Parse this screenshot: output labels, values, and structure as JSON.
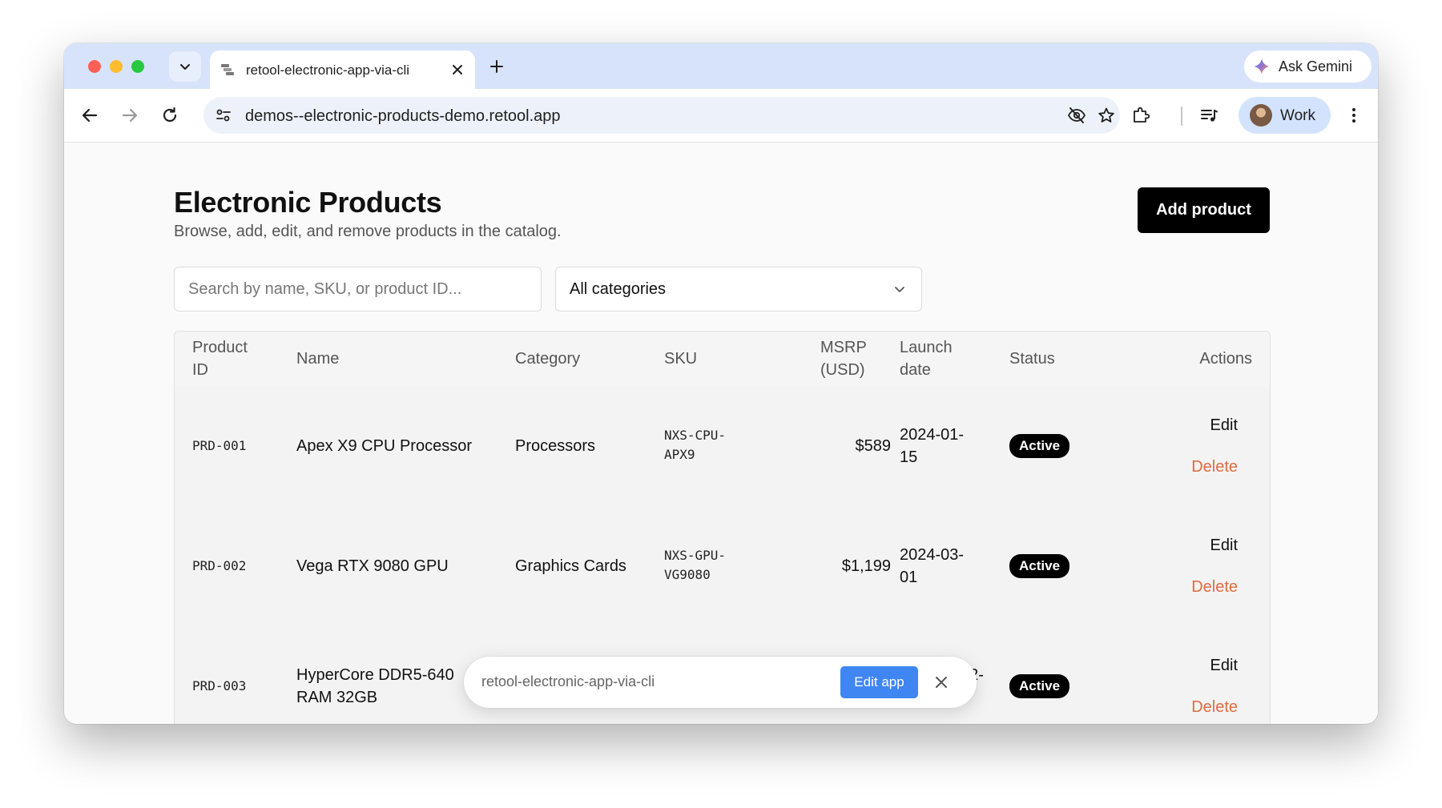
{
  "browser": {
    "tab": {
      "title": "retool-electronic-app-via-cli"
    },
    "gemini_label": "Ask Gemini",
    "url": "demos--electronic-products-demo.retool.app",
    "profile_label": "Work"
  },
  "page": {
    "title": "Electronic Products",
    "subtitle": "Browse, add, edit, and remove products in the catalog.",
    "add_button": "Add product",
    "search_placeholder": "Search by name, SKU, or product ID...",
    "category_filter": "All categories"
  },
  "table": {
    "headers": {
      "product_id": [
        "Product",
        "ID"
      ],
      "name": "Name",
      "category": "Category",
      "sku": "SKU",
      "msrp": [
        "MSRP",
        "(USD)"
      ],
      "launch_date": [
        "Launch",
        "date"
      ],
      "status": "Status",
      "actions": "Actions"
    },
    "rows": [
      {
        "id": "PRD-001",
        "name": [
          "Apex X9 CPU Processor"
        ],
        "category": "Processors",
        "sku": [
          "NXS-CPU-",
          "APX9"
        ],
        "msrp": "$589",
        "launch": [
          "2024-01-",
          "15"
        ],
        "status": "Active",
        "edit": "Edit",
        "delete": "Delete"
      },
      {
        "id": "PRD-002",
        "name": [
          "Vega RTX 9080 GPU"
        ],
        "category": "Graphics Cards",
        "sku": [
          "NXS-GPU-",
          "VG9080"
        ],
        "msrp": "$1,199",
        "launch": [
          "2024-03-",
          "01"
        ],
        "status": "Active",
        "edit": "Edit",
        "delete": "Delete"
      },
      {
        "id": "PRD-003",
        "name": [
          "HyperCore DDR5-640",
          "RAM 32GB"
        ],
        "launch": [
          "02-"
        ],
        "status": "Active",
        "edit": "Edit",
        "delete": "Delete"
      }
    ]
  },
  "floating_bar": {
    "app_name": "retool-electronic-app-via-cli",
    "edit_button": "Edit app"
  }
}
